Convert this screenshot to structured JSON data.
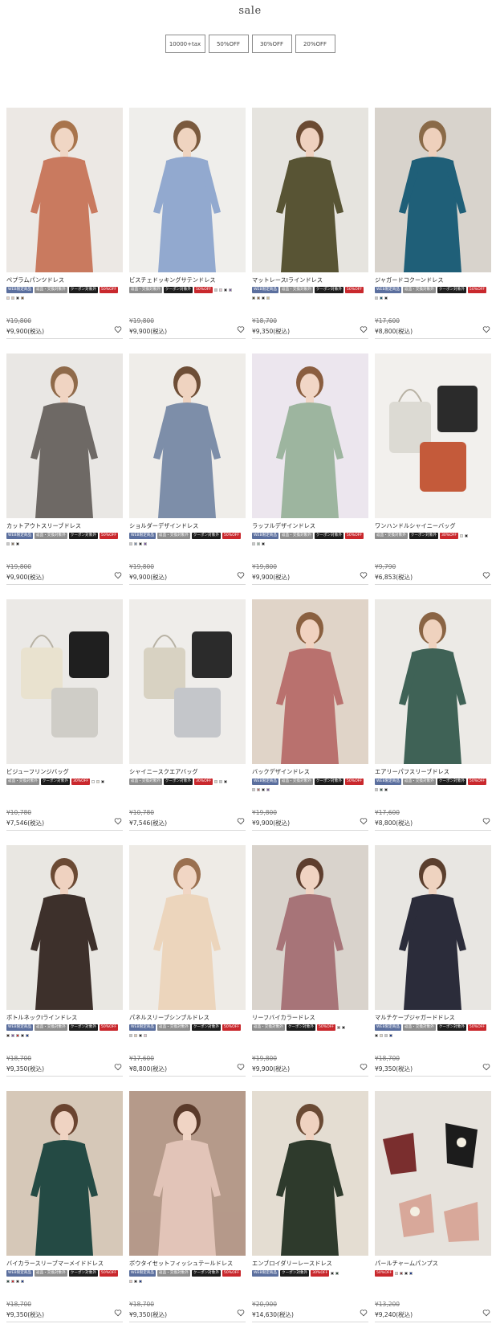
{
  "page": {
    "title": "sale"
  },
  "filters": [
    "10000+tax",
    "50%OFF",
    "30%OFF",
    "20%OFF"
  ],
  "icons": {
    "favorite": "heart-icon"
  },
  "tag_colors": {
    "web": "#5b6f9e",
    "gray": "#8e8e8e",
    "black": "#1c1c1c",
    "red": "#c9282d"
  },
  "products": [
    {
      "name": "ペプラムパンツドレス",
      "tags": [
        [
          "web",
          "WEB限定商品"
        ],
        [
          "gray",
          "返品・交換対象外"
        ],
        [
          "black",
          "クーポン対象外"
        ],
        [
          "red",
          "50%OFF"
        ]
      ],
      "swatches": [
        "#e6d2c8",
        "#d6c2b2",
        "#3a3a3a",
        "#7a5a3a"
      ],
      "old_price": "¥19,800",
      "price": "¥9,900(税込)",
      "img": {
        "bg": "#ece8e4",
        "fig": "#c97a5f",
        "skin": "#f0d6c4",
        "hair": "#a8744c"
      }
    },
    {
      "name": "ビスチェドッキングサテンドレス",
      "tags": [
        [
          "gray",
          "返品・交換対象外"
        ],
        [
          "black",
          "クーポン対象外"
        ],
        [
          "red",
          "50%OFF"
        ]
      ],
      "swatches": [
        "#c8c8c8",
        "#e8c8d0",
        "#2b2b2b",
        "#7b5aa0"
      ],
      "old_price": "¥19,800",
      "price": "¥9,900(税込)",
      "img": {
        "bg": "#efeeeb",
        "fig": "#92a9cf",
        "skin": "#efd4c0",
        "hair": "#7a5a3e"
      }
    },
    {
      "name": "マットレースIラインドレス",
      "tags": [
        [
          "web",
          "WEB限定商品"
        ],
        [
          "gray",
          "返品・交換対象外"
        ],
        [
          "black",
          "クーポン対象外"
        ],
        [
          "red",
          "50%OFF"
        ]
      ],
      "swatches": [
        "#4f4e32",
        "#8a6a4a",
        "#2b2b2b",
        "#c8b890"
      ],
      "old_price": "¥18,700",
      "price": "¥9,350(税込)",
      "img": {
        "bg": "#e6e4df",
        "fig": "#585434",
        "skin": "#efd1bf",
        "hair": "#6b4a32"
      }
    },
    {
      "name": "ジャガードコクーンドレス",
      "tags": [
        [
          "web",
          "WEB限定商品"
        ],
        [
          "gray",
          "返品・交換対象外"
        ],
        [
          "black",
          "クーポン対象外"
        ],
        [
          "red",
          "50%OFF"
        ]
      ],
      "swatches": [
        "#c8c8c8",
        "#1e5d74",
        "#2b2b2b"
      ],
      "old_price": "¥17,600",
      "price": "¥8,800(税込)",
      "img": {
        "bg": "#d8d3cc",
        "fig": "#1f5f78",
        "skin": "#eed0bc",
        "hair": "#8a6a48"
      }
    },
    {
      "name": "カットアウトスリーブドレス",
      "tags": [
        [
          "web",
          "WEB限定商品"
        ],
        [
          "gray",
          "返品・交換対象外"
        ],
        [
          "black",
          "クーポン対象外"
        ],
        [
          "red",
          "50%OFF"
        ]
      ],
      "swatches": [
        "#c8c8c8",
        "#8a7a6a",
        "#2b2b2b"
      ],
      "old_price": "¥19,800",
      "price": "¥9,900(税込)",
      "img": {
        "bg": "#e9e7e4",
        "fig": "#6e6965",
        "skin": "#f0d4c2",
        "hair": "#8f6a4a"
      }
    },
    {
      "name": "ショルダーデザインドレス",
      "tags": [
        [
          "web",
          "WEB限定商品"
        ],
        [
          "gray",
          "返品・交換対象外"
        ],
        [
          "black",
          "クーポン対象外"
        ],
        [
          "red",
          "50%OFF"
        ]
      ],
      "swatches": [
        "#c8c8c8",
        "#7d8fa8",
        "#2b2b2b",
        "#7b5aa0"
      ],
      "old_price": "¥19,800",
      "price": "¥9,900(税込)",
      "img": {
        "bg": "#efede9",
        "fig": "#7d8ea9",
        "skin": "#efd3c0",
        "hair": "#6e4e36"
      }
    },
    {
      "name": "ラッフルデザインドレス",
      "tags": [
        [
          "web",
          "WEB限定商品"
        ],
        [
          "gray",
          "返品・交換対象外"
        ],
        [
          "black",
          "クーポン対象外"
        ],
        [
          "red",
          "50%OFF"
        ]
      ],
      "swatches": [
        "#c8c8c8",
        "#98b6a2",
        "#2b2b2b"
      ],
      "old_price": "¥19,800",
      "price": "¥9,900(税込)",
      "img": {
        "bg": "#ece6ee",
        "fig": "#9db59f",
        "skin": "#f1d6c6",
        "hair": "#8a5e40"
      }
    },
    {
      "name": "ワンハンドルシャイニーバッグ",
      "tags": [
        [
          "gray",
          "返品・交換対象外"
        ],
        [
          "black",
          "クーポン対象外"
        ],
        [
          "red",
          "30%OFF"
        ]
      ],
      "swatches": [
        "#e8e4d8",
        "#2b2b2b"
      ],
      "old_price": "¥9,790",
      "price": "¥6,853(税込)",
      "img": {
        "bg": "#f2f0ed",
        "fig": "#dcdad3",
        "skin": "#2b2b2b",
        "hair": "#c45a3a",
        "bag": true
      }
    },
    {
      "name": "ビジューフリンジバッグ",
      "tags": [
        [
          "gray",
          "返品・交換対象外"
        ],
        [
          "black",
          "クーポン対象外"
        ],
        [
          "red",
          "30%OFF"
        ]
      ],
      "swatches": [
        "#ffffff",
        "#e8e2d2",
        "#2b2b2b"
      ],
      "old_price": "¥10,780",
      "price": "¥7,546(税込)",
      "img": {
        "bg": "#ebe9e6",
        "fig": "#e9e2cf",
        "skin": "#1f1f1f",
        "hair": "#cfcdc7",
        "bag": true
      }
    },
    {
      "name": "シャイニースクエアバッグ",
      "tags": [
        [
          "gray",
          "返品・交換対象外"
        ],
        [
          "black",
          "クーポン対象外"
        ],
        [
          "red",
          "30%OFF"
        ]
      ],
      "swatches": [
        "#e2d8c4",
        "#c8c8c8",
        "#2b2b2b"
      ],
      "old_price": "¥10,780",
      "price": "¥7,546(税込)",
      "img": {
        "bg": "#efedea",
        "fig": "#d8d2c2",
        "skin": "#2b2b2b",
        "hair": "#c4c6ca",
        "bag": true
      }
    },
    {
      "name": "バックデザインドレス",
      "tags": [
        [
          "web",
          "WEB限定商品"
        ],
        [
          "gray",
          "返品・交換対象外"
        ],
        [
          "black",
          "クーポン対象外"
        ],
        [
          "red",
          "50%OFF"
        ]
      ],
      "swatches": [
        "#c8c8c8",
        "#b86a6a",
        "#2b2b2b",
        "#7b5aa0"
      ],
      "old_price": "¥19,800",
      "price": "¥9,900(税込)",
      "img": {
        "bg": "#e0d4c8",
        "fig": "#b9716e",
        "skin": "#f0d2c0",
        "hair": "#8a6040"
      }
    },
    {
      "name": "エアリーパフスリーブドレス",
      "tags": [
        [
          "web",
          "WEB限定商品"
        ],
        [
          "gray",
          "返品・交換対象外"
        ],
        [
          "black",
          "クーポン対象外"
        ],
        [
          "red",
          "50%OFF"
        ]
      ],
      "swatches": [
        "#c8c8c8",
        "#3c5e52",
        "#2b2b2b"
      ],
      "old_price": "¥17,600",
      "price": "¥8,800(税込)",
      "img": {
        "bg": "#eceae6",
        "fig": "#3f6256",
        "skin": "#efd2be",
        "hair": "#8a6444"
      }
    },
    {
      "name": "ボトルネックIラインドレス",
      "tags": [
        [
          "web",
          "WEB限定商品"
        ],
        [
          "gray",
          "返品・交換対象外"
        ],
        [
          "black",
          "クーポン対象外"
        ],
        [
          "red",
          "50%OFF"
        ]
      ],
      "swatches": [
        "#3a2e28",
        "#7b5aa0",
        "#c8282d",
        "#2b2b2b",
        "#1e3a8a"
      ],
      "old_price": "¥18,700",
      "price": "¥9,350(税込)",
      "img": {
        "bg": "#e9e7e2",
        "fig": "#3d302b",
        "skin": "#efd2c0",
        "hair": "#6b4a34"
      }
    },
    {
      "name": "パネルスリーブシンプルドレス",
      "tags": [
        [
          "web",
          "WEB限定商品"
        ],
        [
          "gray",
          "返品・交換対象外"
        ],
        [
          "black",
          "クーポン対象外"
        ],
        [
          "red",
          "50%OFF"
        ]
      ],
      "swatches": [
        "#c8c8c8",
        "#e6c8a8",
        "#2b2b2b",
        "#e8c8d0"
      ],
      "old_price": "¥17,600",
      "price": "¥8,800(税込)",
      "img": {
        "bg": "#eeebe6",
        "fig": "#ecd5bc",
        "skin": "#f1d6c4",
        "hair": "#9a7050"
      }
    },
    {
      "name": "リーフバイカラードレス",
      "tags": [
        [
          "gray",
          "返品・交換対象外"
        ],
        [
          "black",
          "クーポン対象外"
        ],
        [
          "red",
          "50%OFF"
        ]
      ],
      "swatches": [
        "#8a6a6a",
        "#2b2b2b"
      ],
      "old_price": "¥19,800",
      "price": "¥9,900(税込)",
      "img": {
        "bg": "#d9d3cc",
        "fig": "#a77478",
        "skin": "#f0d3c2",
        "hair": "#5e3e2e"
      }
    },
    {
      "name": "マルチケープジャガードドレス",
      "tags": [
        [
          "web",
          "WEB限定商品"
        ],
        [
          "gray",
          "返品・交換対象外"
        ],
        [
          "black",
          "クーポン対象外"
        ],
        [
          "red",
          "50%OFF"
        ]
      ],
      "swatches": [
        "#2b2b2b",
        "#e8dcc8",
        "#c8c8c8",
        "#1e3a8a"
      ],
      "old_price": "¥18,700",
      "price": "¥9,350(税込)",
      "img": {
        "bg": "#e8e6e2",
        "fig": "#2b2c3a",
        "skin": "#efd3c0",
        "hair": "#5b3f2e"
      }
    },
    {
      "name": "バイカラースリーブマーメイドドレス",
      "tags": [
        [
          "web",
          "WEB限定商品"
        ],
        [
          "gray",
          "返品・交換対象外"
        ],
        [
          "black",
          "クーポン対象外"
        ],
        [
          "red",
          "50%OFF"
        ]
      ],
      "swatches": [
        "#2f4f46",
        "#c8282d",
        "#2b2b2b",
        "#1e3a8a"
      ],
      "old_price": "¥18,700",
      "price": "¥9,350(税込)",
      "img": {
        "bg": "#d6c8b8",
        "fig": "#244a44",
        "skin": "#efd3c2",
        "hair": "#6a4430"
      }
    },
    {
      "name": "ボウタイセットフィッシュテールドレス",
      "tags": [
        [
          "web",
          "WEB限定商品"
        ],
        [
          "gray",
          "返品・交換対象外"
        ],
        [
          "black",
          "クーポン対象外"
        ],
        [
          "red",
          "50%OFF"
        ]
      ],
      "swatches": [
        "#e8c8c0",
        "#2b2b2b",
        "#1e3a8a"
      ],
      "old_price": "¥18,700",
      "price": "¥9,350(税込)",
      "img": {
        "bg": "#b59a8a",
        "fig": "#e2c4b8",
        "skin": "#f0d4c4",
        "hair": "#5a3a2a"
      }
    },
    {
      "name": "エンブロイダリーレースドレス",
      "tags": [
        [
          "web",
          "WEB限定商品"
        ],
        [
          "black",
          "クーポン対象外"
        ],
        [
          "red",
          "30%OFF"
        ]
      ],
      "swatches": [
        "#2b2b2b",
        "#2f4f3a"
      ],
      "old_price": "¥20,900",
      "price": "¥14,630(税込)",
      "img": {
        "bg": "#e4ddd2",
        "fig": "#2e3a2c",
        "skin": "#efd2c0",
        "hair": "#6a4a34"
      }
    },
    {
      "name": "パールチャームパンプス",
      "tags": [
        [
          "red",
          "50%OFF"
        ]
      ],
      "swatches": [
        "#e8c8b8",
        "#8a3a3a",
        "#2b2b2b",
        "#1e3a8a"
      ],
      "old_price": "¥13,200",
      "price": "¥9,240(税込)",
      "img": {
        "bg": "#e6e2dc",
        "fig": "#d8a89a",
        "skin": "#1c1c1c",
        "hair": "#7a2e2e",
        "shoe": true
      }
    }
  ]
}
